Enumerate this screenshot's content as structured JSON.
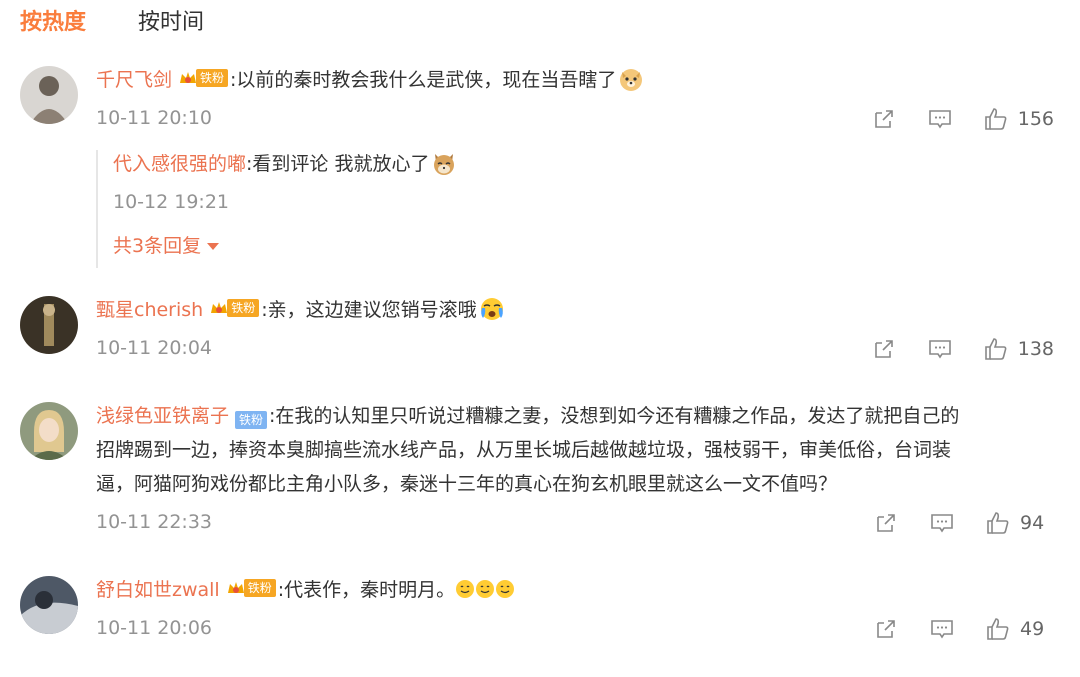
{
  "sort_tabs": {
    "hot": "按热度",
    "time": "按时间"
  },
  "comments": [
    {
      "user": "千尺飞剑",
      "badge": "铁粉",
      "text": ":以前的秦时教会我什么是武侠，现在当吾瞎了",
      "time": "10-11 20:10",
      "likes": "156",
      "reply": {
        "user": "代入感很强的嘟",
        "text": ":看到评论 我就放心了",
        "time": "10-12 19:21",
        "more": "共3条回复"
      }
    },
    {
      "user": "甄星cherish",
      "badge": "铁粉",
      "text": ":亲，这边建议您销号滚哦",
      "time": "10-11 20:04",
      "likes": "138"
    },
    {
      "user": "浅绿色亚铁离子",
      "badge": "铁粉",
      "text_line1": ":在我的认知里只听说过糟糠之妻，没想到如今还有糟糠之作品，发达了就把自己的",
      "text_line2": "招牌踢到一边，捧资本臭脚搞些流水线产品，从万里长城后越做越垃圾，强枝弱干，审美低俗，台词装",
      "text_line3": "逼，阿猫阿狗戏份都比主角小队多，秦迷十三年的真心在狗玄机眼里就这么一文不值吗？",
      "time": "10-11 22:33",
      "likes": "94"
    },
    {
      "user": "舒白如世zwall",
      "badge": "铁粉",
      "text": ":代表作，秦时明月。",
      "time": "10-11 20:06",
      "likes": "49"
    }
  ],
  "colors": {
    "accent": "#fa7d3c",
    "username": "#eb7350",
    "badge": "#f6a623",
    "badge_blue": "#7fb4f2",
    "meta": "#939393"
  },
  "icons": {
    "share": "share-icon",
    "comment": "comment-icon",
    "like": "thumbs-up-icon"
  }
}
